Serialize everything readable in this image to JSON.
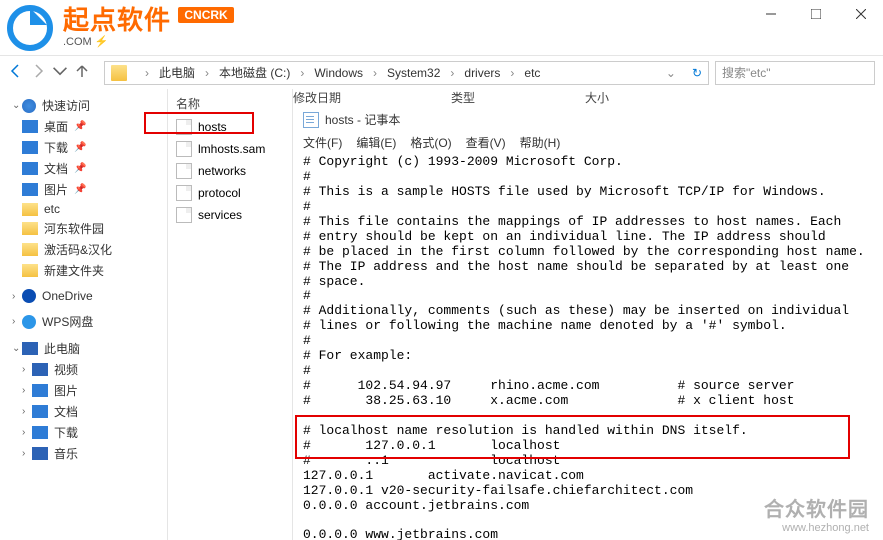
{
  "logo": {
    "ch": "起点软件",
    "badge": "CNCRK",
    "sub": ".COM ⚡"
  },
  "breadcrumb": [
    "此电脑",
    "本地磁盘 (C:)",
    "Windows",
    "System32",
    "drivers",
    "etc"
  ],
  "search_placeholder": "搜索\"etc\"",
  "columns": {
    "name": "名称",
    "date": "修改日期",
    "type": "类型",
    "size": "大小"
  },
  "sidebar": {
    "quick": {
      "header": "快速访问",
      "items": [
        "桌面",
        "下载",
        "文档",
        "图片",
        "etc",
        "河东软件园",
        "激活码&汉化",
        "新建文件夹"
      ]
    },
    "onedrive": "OneDrive",
    "wps": "WPS网盘",
    "pc": {
      "header": "此电脑",
      "items": [
        "视频",
        "图片",
        "文档",
        "下载",
        "音乐"
      ]
    }
  },
  "files": [
    "hosts",
    "lmhosts.sam",
    "networks",
    "protocol",
    "services"
  ],
  "notepad": {
    "title": "hosts - 记事本",
    "menu": [
      "文件(F)",
      "编辑(E)",
      "格式(O)",
      "查看(V)",
      "帮助(H)"
    ],
    "content": "# Copyright (c) 1993-2009 Microsoft Corp.\n#\n# This is a sample HOSTS file used by Microsoft TCP/IP for Windows.\n#\n# This file contains the mappings of IP addresses to host names. Each\n# entry should be kept on an individual line. The IP address should\n# be placed in the first column followed by the corresponding host name.\n# The IP address and the host name should be separated by at least one\n# space.\n#\n# Additionally, comments (such as these) may be inserted on individual\n# lines or following the machine name denoted by a '#' symbol.\n#\n# For example:\n#\n#      102.54.94.97     rhino.acme.com          # source server\n#       38.25.63.10     x.acme.com              # x client host\n\n# localhost name resolution is handled within DNS itself.\n#       127.0.0.1       localhost\n#       ::1             localhost\n127.0.0.1       activate.navicat.com\n127.0.0.1 v20-security-failsafe.chiefarchitect.com\n0.0.0.0 account.jetbrains.com\n\n0.0.0.0 www.jetbrains.com"
  },
  "watermark": {
    "ch": "合众软件园",
    "url": "www.hezhong.net"
  }
}
